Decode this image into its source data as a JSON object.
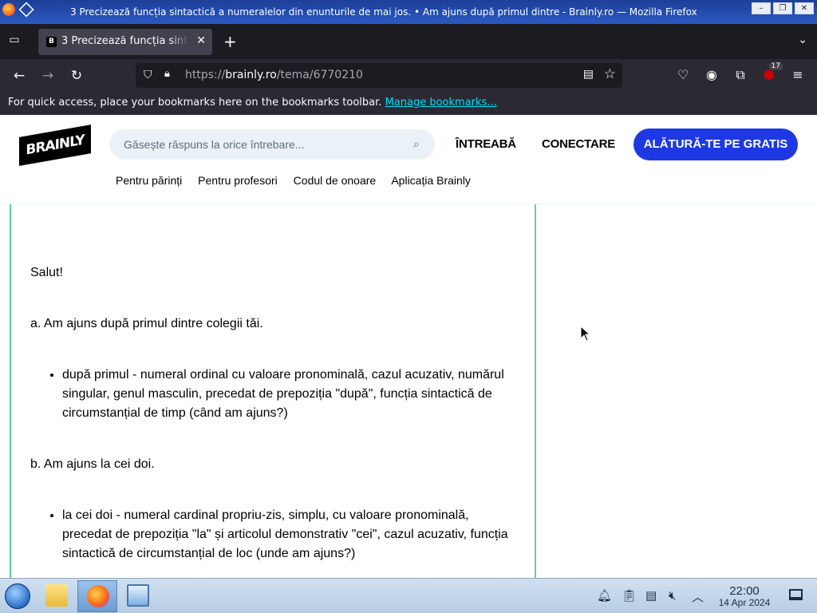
{
  "window": {
    "title": "3 Precizează funcția sintactică a numeralelor din enunturile de mai jos. • Am ajuns după primul dintre - Brainly.ro — Mozilla Firefox",
    "buttons": [
      "–",
      "❐",
      "✕"
    ]
  },
  "tabs": {
    "active": {
      "favicon": "brainly-favicon",
      "title": "3 Precizează funcția sintactică a numeralelor"
    },
    "new_tab_label": "+"
  },
  "nav": {
    "url_prefix": "https://",
    "url_domain": "brainly.ro",
    "url_path": "/tema/6770210",
    "extension_badge": "17"
  },
  "bookmarks_bar": {
    "message": "For quick access, place your bookmarks here on the bookmarks toolbar.",
    "link": "Manage bookmarks..."
  },
  "site": {
    "logo": "BRAINLY",
    "search_placeholder": "Găsește răspuns la orice întrebare...",
    "ask": "ÎNTREABĂ",
    "login": "CONECTARE",
    "join": "ALĂTURĂ-TE PE GRATIS",
    "subnav": [
      "Pentru părinți",
      "Pentru profesori",
      "Codul de onoare",
      "Aplicația Brainly"
    ]
  },
  "answer": {
    "greeting": "Salut!",
    "a_sentence": "a. Am ajuns după primul dintre colegii tăi.",
    "a_bullet": "după primul - numeral ordinal cu valoare pronominală, cazul acuzativ, numărul singular, genul masculin, precedat de prepoziția \"după\", funcția sintactică de circumstanțial de timp (când am ajuns?)",
    "b_sentence": "b. Am ajuns la cei doi.",
    "b_bullet": "la cei doi - numeral cardinal propriu-zis, simplu, cu valoare pronominală, precedat de prepoziția \"la\" și articolul demonstrativ \"cei\", cazul acuzativ, funcția sintactică de circumstanțial de loc (unde am ajuns?)"
  },
  "taskbar": {
    "time": "22:00",
    "date": "14 Apr 2024"
  }
}
